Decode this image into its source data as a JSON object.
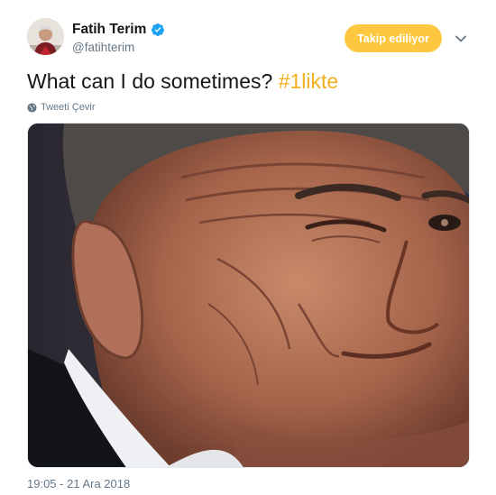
{
  "header": {
    "display_name": "Fatih Terim",
    "handle": "@fatihterim",
    "follow_button": "Takip ediliyor"
  },
  "tweet": {
    "text": "What can I do sometimes?",
    "hashtag": "#1likte",
    "translate_label": "Tweeti Çevir",
    "timestamp": "19:05 - 21 Ara 2018"
  },
  "colors": {
    "follow_button_bg": "#fdc840",
    "hashtag": "#f2b01e",
    "verified_badge": "#1da1f2"
  },
  "icons": {
    "verified": "verified-badge-icon",
    "caret": "chevron-down-icon",
    "translate": "globe-icon"
  }
}
